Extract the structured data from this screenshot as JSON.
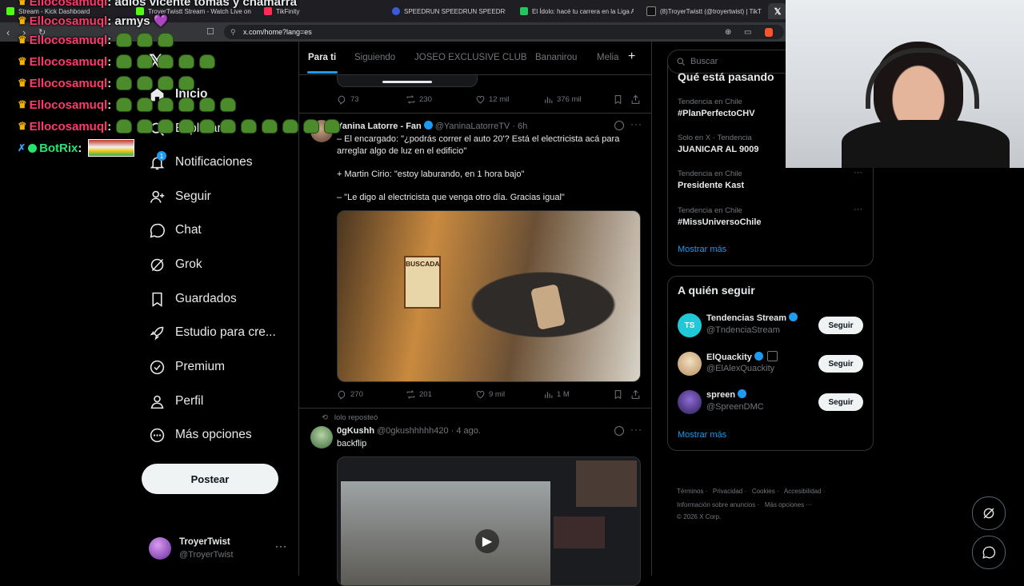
{
  "browser": {
    "tabs": [
      {
        "label": "Stream - Kick Dashboard",
        "color": "#53fc18"
      },
      {
        "label": "TroyerTwistt Stream - Watch Live on",
        "color": "#53fc18"
      },
      {
        "label": "TikFinity",
        "color": "#ff2c55"
      },
      {
        "label": "SPEEDRUN SPEEDRUN SPEEDRUN S",
        "color": "#3b5bdb"
      },
      {
        "label": "El Ídolo: hacé tu carrera en la Liga A",
        "color": "#22c55e"
      },
      {
        "label": "(8)TroyerTwistt (@troyertwist) | TikT",
        "color": "#111111"
      }
    ],
    "url": "x.com/home?lang=es"
  },
  "chat": {
    "lines": [
      {
        "user": "Ellocosamuql",
        "text": ": adios vicente tomas y chamarra",
        "frogs": 0
      },
      {
        "user": "Ellocosamuql",
        "text": ": armys 💜",
        "frogs": 0
      },
      {
        "user": "Ellocosamuql",
        "text": ":",
        "frogs": 3
      },
      {
        "user": "Ellocosamuql",
        "text": ":",
        "frogs": 5
      },
      {
        "user": "Ellocosamuql",
        "text": ":",
        "frogs": 4
      },
      {
        "user": "Ellocosamuql",
        "text": ":",
        "frogs": 6
      },
      {
        "user": "Ellocosamuql",
        "text": ":",
        "frogs": 11
      }
    ],
    "bot": {
      "user": "BotRix",
      "text": ":"
    }
  },
  "nav": {
    "items": [
      {
        "label": "Inicio",
        "icon": "home-icon"
      },
      {
        "label": "Explorar",
        "icon": "search-icon"
      },
      {
        "label": "Notificaciones",
        "icon": "bell-icon"
      },
      {
        "label": "Seguir",
        "icon": "follow-icon"
      },
      {
        "label": "Chat",
        "icon": "chat-icon"
      },
      {
        "label": "Grok",
        "icon": "grok-icon"
      },
      {
        "label": "Guardados",
        "icon": "bookmark-icon"
      },
      {
        "label": "Estudio para cre...",
        "icon": "rocket-icon"
      },
      {
        "label": "Premium",
        "icon": "premium-icon"
      },
      {
        "label": "Perfil",
        "icon": "person-icon"
      },
      {
        "label": "Más opciones",
        "icon": "more-circle-icon"
      }
    ],
    "notif_badge": "1",
    "post_label": "Postear",
    "profile": {
      "name": "TroyerTwist",
      "handle": "@TroyerTwist"
    }
  },
  "feed": {
    "tabs": [
      "Para ti",
      "Siguiendo",
      "JOSEO EXCLUSIVE CLUB",
      "Bananirou",
      "Melia"
    ],
    "tweet0": {
      "replies": "73",
      "reposts": "230",
      "likes": "12 mil",
      "views": "376 mil"
    },
    "tweet1": {
      "name": "Yanina Latorre - Fan",
      "handle": "@YaninaLatorreTV",
      "time": "· 6h",
      "lines": [
        "– El encargado: \"¿podrás correr el auto 20'? Está el electricista acá para arreglar algo de luz en el edificio\"",
        "+ Martin Cirio: \"estoy laburando, en 1 hora bajo\"",
        "– \"Le digo al electricista que venga otro día. Gracias igual\""
      ],
      "media_text": "BUSCADA",
      "replies": "270",
      "reposts": "201",
      "likes": "9 mil",
      "views": "1 M"
    },
    "tweet2": {
      "repost_label": "lolo reposteó",
      "name": "0gKushh",
      "handle": "@0gkushhhhh420",
      "time": "· 4 ago.",
      "text": "backflip"
    }
  },
  "sidebar": {
    "search_placeholder": "Buscar",
    "trends_title": "Qué está pasando",
    "trends": [
      {
        "context": "Tendencia en Chile",
        "name": "#PlanPerfectoCHV"
      },
      {
        "context": "Solo en X · Tendencia",
        "name": "JUANICAR AL 9009"
      },
      {
        "context": "Tendencia en Chile",
        "name": "Presidente Kast"
      },
      {
        "context": "Tendencia en Chile",
        "name": "#MissUniversoChile"
      }
    ],
    "trends_more": "Mostrar más",
    "follow_title": "A quién seguir",
    "follow": [
      {
        "name": "Tendencias Stream",
        "handle": "@TndenciaStream",
        "button": "Seguir",
        "color": "#20c9d8"
      },
      {
        "name": "ElQuackity",
        "handle": "@ElAlexQuackity",
        "button": "Seguir",
        "color": "#e8d0b0"
      },
      {
        "name": "spreen",
        "handle": "@SpreenDMC",
        "button": "Seguir",
        "color": "#5b3fa0"
      }
    ],
    "follow_more": "Mostrar más",
    "footer": {
      "row1": [
        "Términos",
        "Privacidad",
        "Cookies",
        "Accesibilidad"
      ],
      "row2": [
        "Información sobre anuncios",
        "Más opciones ···"
      ],
      "copyright": "© 2026 X Corp."
    }
  },
  "colors": {
    "accent": "#1d9bf0",
    "chat_user": "#ff3a6b",
    "bot_user": "#27e36f"
  }
}
